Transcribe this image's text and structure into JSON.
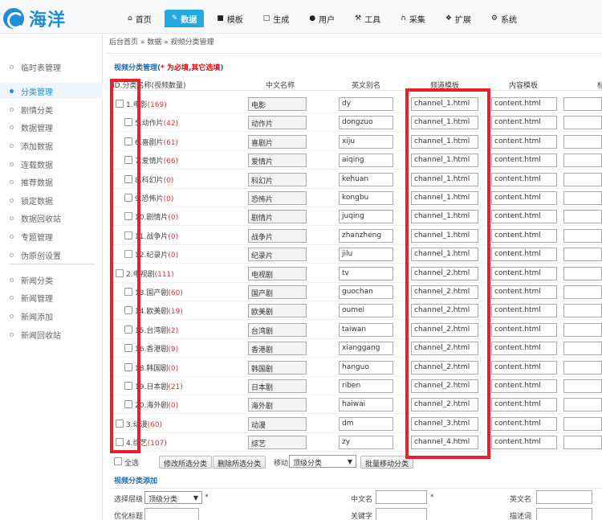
{
  "logo": {
    "text": "海洋"
  },
  "nav": [
    {
      "icon": "home-icon",
      "glyph": "⌂",
      "label": "首页"
    },
    {
      "icon": "edit-icon",
      "glyph": "✎",
      "label": "数据",
      "active": true
    },
    {
      "icon": "template-icon",
      "glyph": "■",
      "label": "模板"
    },
    {
      "icon": "file-icon",
      "glyph": "□",
      "label": "生成"
    },
    {
      "icon": "user-icon",
      "glyph": "●",
      "label": "用户"
    },
    {
      "icon": "wrench-icon",
      "glyph": "⚒",
      "label": "工具"
    },
    {
      "icon": "magnet-icon",
      "glyph": "∩",
      "label": "采集"
    },
    {
      "icon": "puzzle-icon",
      "glyph": "❖",
      "label": "扩展"
    },
    {
      "icon": "gear-icon",
      "glyph": "⚙",
      "label": "系统"
    }
  ],
  "breadcrumb": "后台首页 » 数据 » 视频分类管理",
  "sidebar": [
    {
      "label": "临时表管理"
    },
    {
      "label": "分类管理",
      "active": true
    },
    {
      "label": "剧情分类"
    },
    {
      "label": "数据管理"
    },
    {
      "label": "添加数据"
    },
    {
      "label": "连载数据"
    },
    {
      "label": "推荐数据"
    },
    {
      "label": "锁定数据"
    },
    {
      "label": "数据回收站"
    },
    {
      "label": "专题管理"
    },
    {
      "label": "伪原创设置"
    },
    {
      "label": "新闻分类"
    },
    {
      "label": "新闻管理"
    },
    {
      "label": "新闻添加"
    },
    {
      "label": "新闻回收站"
    }
  ],
  "section": {
    "title": "视频分类管理(",
    "required_note": "* 为必填,其它选填",
    "close": ")"
  },
  "columns": {
    "id_name": "ID.分类名称(视频数量)",
    "cn": "中文名称",
    "en": "英文别名",
    "channel": "频道模板",
    "content": "内容模板",
    "extra": "标"
  },
  "rows": [
    {
      "level": 0,
      "name": "1.电影",
      "count": "(169)",
      "cn": "电影",
      "en": "dy",
      "channel": "channel_1.html",
      "content": "content.html"
    },
    {
      "level": 1,
      "name": "5.动作片",
      "count": "(42)",
      "cn": "动作片",
      "en": "dongzuo",
      "channel": "channel_1.html",
      "content": "content.html"
    },
    {
      "level": 1,
      "name": "6.喜剧片",
      "count": "(61)",
      "cn": "喜剧片",
      "en": "xiju",
      "channel": "channel_1.html",
      "content": "content.html"
    },
    {
      "level": 1,
      "name": "7.爱情片",
      "count": "(66)",
      "cn": "爱情片",
      "en": "aiqing",
      "channel": "channel_1.html",
      "content": "content.html"
    },
    {
      "level": 1,
      "name": "8.科幻片",
      "count": "(0)",
      "cn": "科幻片",
      "en": "kehuan",
      "channel": "channel_1.html",
      "content": "content.html"
    },
    {
      "level": 1,
      "name": "9.恐怖片",
      "count": "(0)",
      "cn": "恐怖片",
      "en": "kongbu",
      "channel": "channel_1.html",
      "content": "content.html"
    },
    {
      "level": 1,
      "name": "10.剧情片",
      "count": "(0)",
      "cn": "剧情片",
      "en": "juqing",
      "channel": "channel_1.html",
      "content": "content.html"
    },
    {
      "level": 1,
      "name": "11.战争片",
      "count": "(0)",
      "cn": "战争片",
      "en": "zhanzheng",
      "channel": "channel_1.html",
      "content": "content.html"
    },
    {
      "level": 1,
      "name": "12.纪录片",
      "count": "(0)",
      "cn": "纪录片",
      "en": "jilu",
      "channel": "channel_1.html",
      "content": "content.html"
    },
    {
      "level": 0,
      "name": "2.电视剧",
      "count": "(111)",
      "cn": "电视剧",
      "en": "tv",
      "channel": "channel_2.html",
      "content": "content.html"
    },
    {
      "level": 1,
      "name": "13.国产剧",
      "count": "(60)",
      "cn": "国产剧",
      "en": "guochan",
      "channel": "channel_2.html",
      "content": "content.html"
    },
    {
      "level": 1,
      "name": "14.欧美剧",
      "count": "(19)",
      "cn": "欧美剧",
      "en": "oumei",
      "channel": "channel_2.html",
      "content": "content.html"
    },
    {
      "level": 1,
      "name": "15.台湾剧",
      "count": "(2)",
      "cn": "台湾剧",
      "en": "taiwan",
      "channel": "channel_2.html",
      "content": "content.html"
    },
    {
      "level": 1,
      "name": "16.香港剧",
      "count": "(9)",
      "cn": "香港剧",
      "en": "xianggang",
      "channel": "channel_2.html",
      "content": "content.html"
    },
    {
      "level": 1,
      "name": "18.韩国剧",
      "count": "(0)",
      "cn": "韩国剧",
      "en": "hanguo",
      "channel": "channel_2.html",
      "content": "content.html"
    },
    {
      "level": 1,
      "name": "19.日本剧",
      "count": "(21)",
      "cn": "日本剧",
      "en": "riben",
      "channel": "channel_2.html",
      "content": "content.html"
    },
    {
      "level": 1,
      "name": "20.海外剧",
      "count": "(0)",
      "cn": "海外剧",
      "en": "haiwai",
      "channel": "channel_2.html",
      "content": "content.html"
    },
    {
      "level": 0,
      "name": "3.动漫",
      "count": "(60)",
      "cn": "动漫",
      "en": "dm",
      "channel": "channel_3.html",
      "content": "content.html"
    },
    {
      "level": 0,
      "name": "4.综艺",
      "count": "(107)",
      "cn": "综艺",
      "en": "zy",
      "channel": "channel_4.html",
      "content": "content.html"
    }
  ],
  "footer": {
    "select_all": "全选",
    "edit_selected": "修改所选分类",
    "delete_selected": "删除所选分类",
    "move_to": "移动到",
    "move_target": "顶级分类",
    "batch_move": "批量移动分类"
  },
  "add_form": {
    "title": "视频分类添加",
    "level_label": "选择层级",
    "level_value": "顶级分类",
    "cn_label": "中文名",
    "en_label": "英文名",
    "seo_title_label": "优化标题",
    "keywords_label": "关键字",
    "description_label": "描述词",
    "required_mark": "*"
  },
  "colors": {
    "accent": "#26a9e0",
    "highlight": "#e8202a",
    "count": "#d33333"
  }
}
